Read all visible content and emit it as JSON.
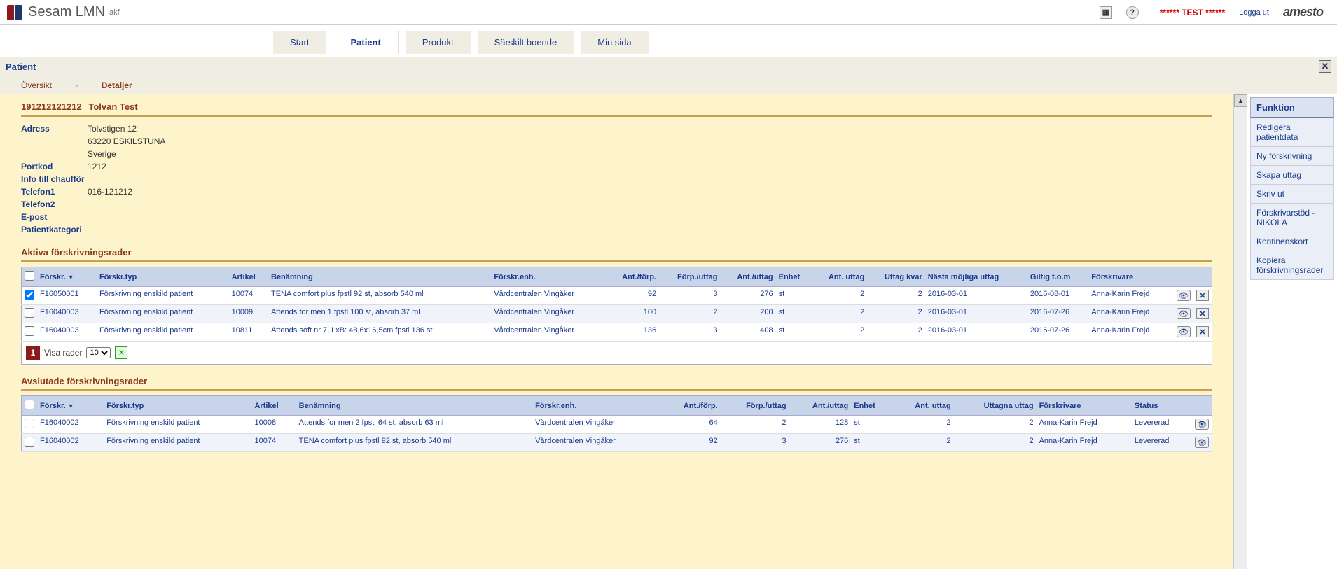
{
  "header": {
    "app_title": "Sesam LMN",
    "app_sub": "akf",
    "test_banner": "****** TEST ******",
    "logout": "Logga ut",
    "brand": "amesto"
  },
  "nav": {
    "items": [
      "Start",
      "Patient",
      "Produkt",
      "Särskilt boende",
      "Min sida"
    ],
    "active": 1
  },
  "subbar": {
    "title": "Patient"
  },
  "crumb": {
    "overview": "Översikt",
    "detail": "Detaljer"
  },
  "side": {
    "head": "Funktion",
    "items": [
      "Redigera patientdata",
      "Ny förskrivning",
      "Skapa uttag",
      "Skriv ut",
      "Förskrivarstöd - NIKOLA",
      "Kontinenskort",
      "Kopiera förskrivningsrader"
    ]
  },
  "patient": {
    "id": "191212121212",
    "name": "Tolvan Test",
    "labels": {
      "adress": "Adress",
      "portkod": "Portkod",
      "info": "Info till chaufför",
      "tel1": "Telefon1",
      "tel2": "Telefon2",
      "epost": "E-post",
      "kat": "Patientkategori"
    },
    "adress1": "Tolvstigen 12",
    "adress2": "63220 ESKILSTUNA",
    "adress3": "Sverige",
    "portkod": "1212",
    "info": "",
    "tel1": "016-121212",
    "tel2": "",
    "epost": "",
    "kat": ""
  },
  "active_sec": "Aktiva förskrivningsrader",
  "closed_sec": "Avslutade förskrivningsrader",
  "cols_active": {
    "forskr": "Förskr.",
    "typ": "Förskr.typ",
    "artikel": "Artikel",
    "benamn": "Benämning",
    "enh": "Förskr.enh.",
    "antforp": "Ant./förp.",
    "forputtag": "Förp./uttag",
    "antuttag": "Ant./uttag",
    "enhet": "Enhet",
    "ant_uttag": "Ant. uttag",
    "uttag_kvar": "Uttag kvar",
    "nasta": "Nästa möjliga uttag",
    "giltig": "Giltig t.o.m",
    "forskrivare": "Förskrivare"
  },
  "rows_active": [
    {
      "chk": true,
      "forskr": "F16050001",
      "typ": "Förskrivning enskild patient",
      "artikel": "10074",
      "benamn": "TENA comfort plus fpstl 92 st, absorb 540 ml",
      "enh": "Vårdcentralen Vingåker",
      "antforp": "92",
      "forputtag": "3",
      "antuttag": "276",
      "enhet": "st",
      "ant_uttag": "2",
      "uttag_kvar": "2",
      "nasta": "2016-03-01",
      "giltig": "2016-08-01",
      "forskrivare": "Anna-Karin Frejd"
    },
    {
      "chk": false,
      "forskr": "F16040003",
      "typ": "Förskrivning enskild patient",
      "artikel": "10009",
      "benamn": "Attends for men 1 fpstl 100 st, absorb 37 ml",
      "enh": "Vårdcentralen Vingåker",
      "antforp": "100",
      "forputtag": "2",
      "antuttag": "200",
      "enhet": "st",
      "ant_uttag": "2",
      "uttag_kvar": "2",
      "nasta": "2016-03-01",
      "giltig": "2016-07-26",
      "forskrivare": "Anna-Karin Frejd"
    },
    {
      "chk": false,
      "forskr": "F16040003",
      "typ": "Förskrivning enskild patient",
      "artikel": "10811",
      "benamn": "Attends soft nr 7, LxB: 48,6x16,5cm fpstl 136 st",
      "enh": "Vårdcentralen Vingåker",
      "antforp": "136",
      "forputtag": "3",
      "antuttag": "408",
      "enhet": "st",
      "ant_uttag": "2",
      "uttag_kvar": "2",
      "nasta": "2016-03-01",
      "giltig": "2016-07-26",
      "forskrivare": "Anna-Karin Frejd"
    }
  ],
  "pager": {
    "page": "1",
    "label": "Visa rader",
    "size": "10"
  },
  "cols_closed": {
    "forskr": "Förskr.",
    "typ": "Förskr.typ",
    "artikel": "Artikel",
    "benamn": "Benämning",
    "enh": "Förskr.enh.",
    "antforp": "Ant./förp.",
    "forputtag": "Förp./uttag",
    "antuttag": "Ant./uttag",
    "enhet": "Enhet",
    "ant_uttag": "Ant. uttag",
    "uttagna": "Uttagna uttag",
    "forskrivare": "Förskrivare",
    "status": "Status"
  },
  "rows_closed": [
    {
      "forskr": "F16040002",
      "typ": "Förskrivning enskild patient",
      "artikel": "10008",
      "benamn": "Attends for men 2 fpstl 64 st, absorb 63 ml",
      "enh": "Vårdcentralen Vingåker",
      "antforp": "64",
      "forputtag": "2",
      "antuttag": "128",
      "enhet": "st",
      "ant_uttag": "2",
      "uttagna": "2",
      "forskrivare": "Anna-Karin Frejd",
      "status": "Levererad"
    },
    {
      "forskr": "F16040002",
      "typ": "Förskrivning enskild patient",
      "artikel": "10074",
      "benamn": "TENA comfort plus fpstl 92 st, absorb 540 ml",
      "enh": "Vårdcentralen Vingåker",
      "antforp": "92",
      "forputtag": "3",
      "antuttag": "276",
      "enhet": "st",
      "ant_uttag": "2",
      "uttagna": "2",
      "forskrivare": "Anna-Karin Frejd",
      "status": "Levererad"
    }
  ]
}
